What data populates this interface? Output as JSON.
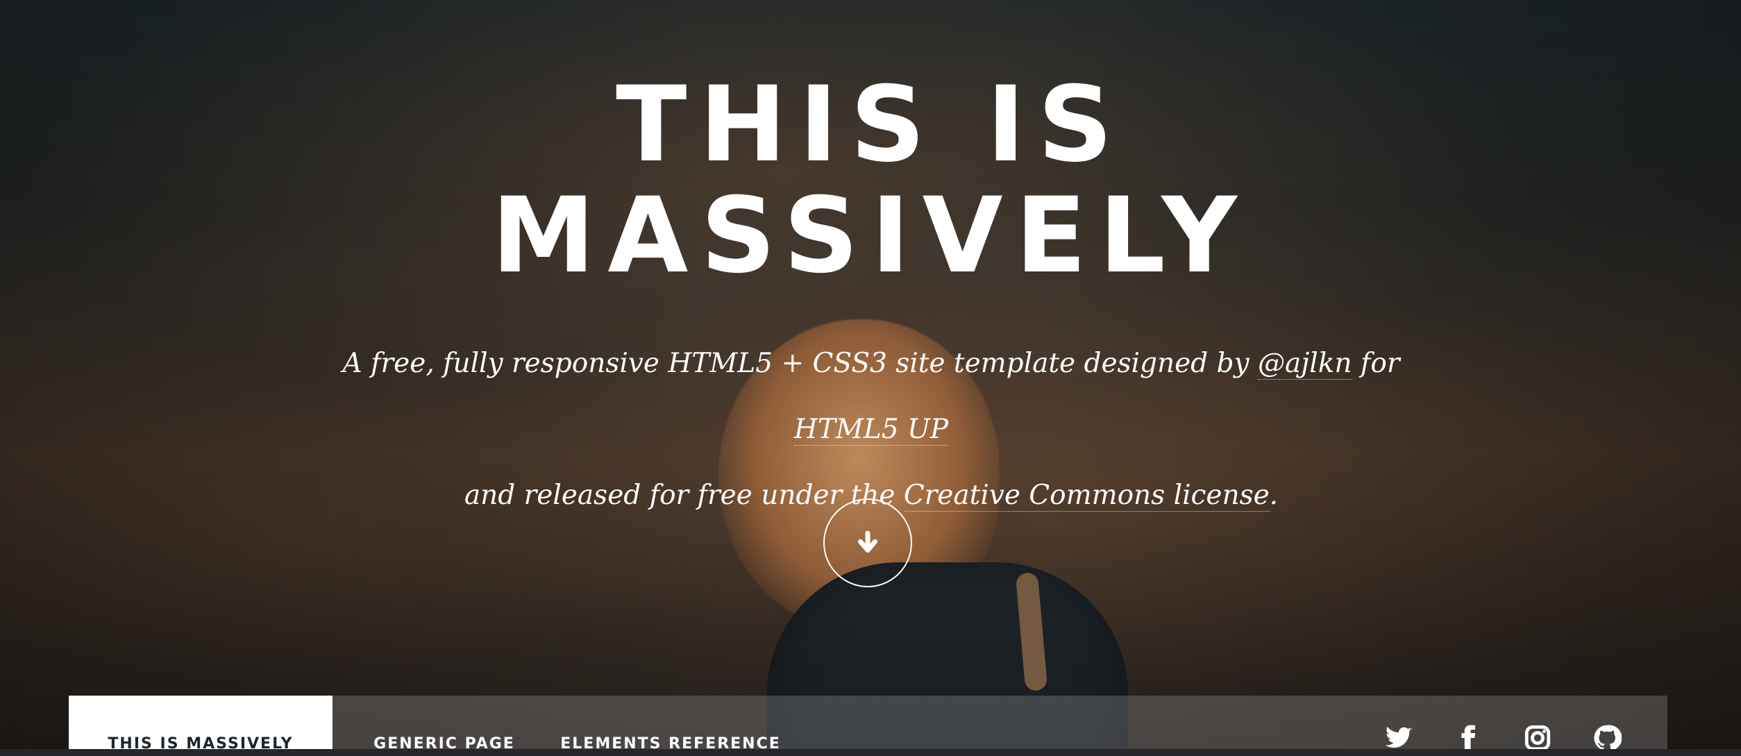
{
  "hero": {
    "title_line_1": "THIS IS",
    "title_line_2": "MASSIVELY",
    "intro_prefix": "A free, fully responsive HTML5 + CSS3 site template designed by ",
    "intro_link_author": "@ajlkn",
    "intro_mid": " for ",
    "intro_link_site": "HTML5 UP",
    "intro_line_2": "and released for free under the ",
    "intro_link_license": "Creative Commons license",
    "intro_end": ".",
    "scroll_icon": "arrow-down-icon"
  },
  "nav": {
    "items": [
      {
        "label": "THIS IS MASSIVELY",
        "active": true
      },
      {
        "label": "GENERIC PAGE"
      },
      {
        "label": "ELEMENTS REFERENCE"
      }
    ],
    "social_icons": [
      "twitter-icon",
      "facebook-icon",
      "instagram-icon",
      "github-icon"
    ]
  },
  "colors": {
    "text": "#ffffff",
    "active_nav_background": "#ffffff",
    "active_nav_text": "#1e252d"
  }
}
